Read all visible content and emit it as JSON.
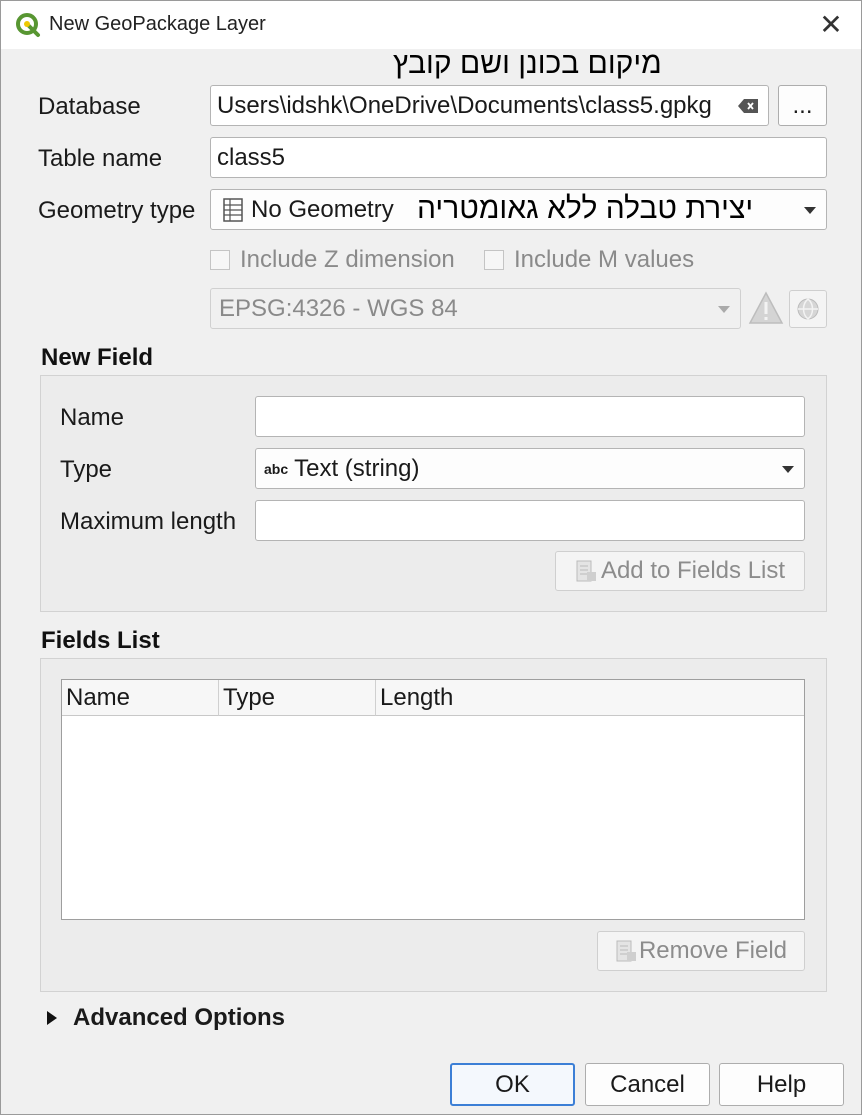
{
  "window": {
    "title": "New GeoPackage Layer",
    "close_glyph": "✕"
  },
  "form": {
    "database_label": "Database",
    "database_value": "Users\\idshk\\OneDrive\\Documents\\class5.gpkg",
    "browse_label": "...",
    "table_name_label": "Table name",
    "table_name_value": "class5",
    "geometry_type_label": "Geometry type",
    "geometry_type_value": "No Geometry",
    "include_z_label": "Include Z dimension",
    "include_m_label": "Include M values",
    "crs_value": "EPSG:4326 - WGS 84"
  },
  "annotations": {
    "location_note": "מיקום בכונן ושם קובץ",
    "geometry_note": "יצירת טבלה ללא גאומטריה"
  },
  "new_field": {
    "section_title": "New Field",
    "name_label": "Name",
    "name_value": "",
    "type_label": "Type",
    "type_prefix": "abc",
    "type_value": "Text (string)",
    "max_length_label": "Maximum length",
    "max_length_value": "",
    "add_button_label": "Add to Fields List"
  },
  "fields_list": {
    "section_title": "Fields List",
    "columns": [
      "Name",
      "Type",
      "Length"
    ],
    "rows": [],
    "remove_button_label": "Remove Field"
  },
  "advanced": {
    "label": "Advanced Options"
  },
  "footer": {
    "ok_label": "OK",
    "cancel_label": "Cancel",
    "help_label": "Help"
  },
  "colors": {
    "accent": "#3c7fd6",
    "qgis_green": "#589632",
    "qgis_yellow": "#eec900",
    "warning": "#c9c9c9"
  },
  "icons": {
    "app": "qgis-logo-icon",
    "clear": "clear-text-icon",
    "geometry": "table-icon",
    "warning": "warning-icon",
    "crs_select": "globe-icon",
    "add_field": "add-field-icon",
    "remove_field": "remove-field-icon",
    "expand": "expand-triangle-icon"
  }
}
